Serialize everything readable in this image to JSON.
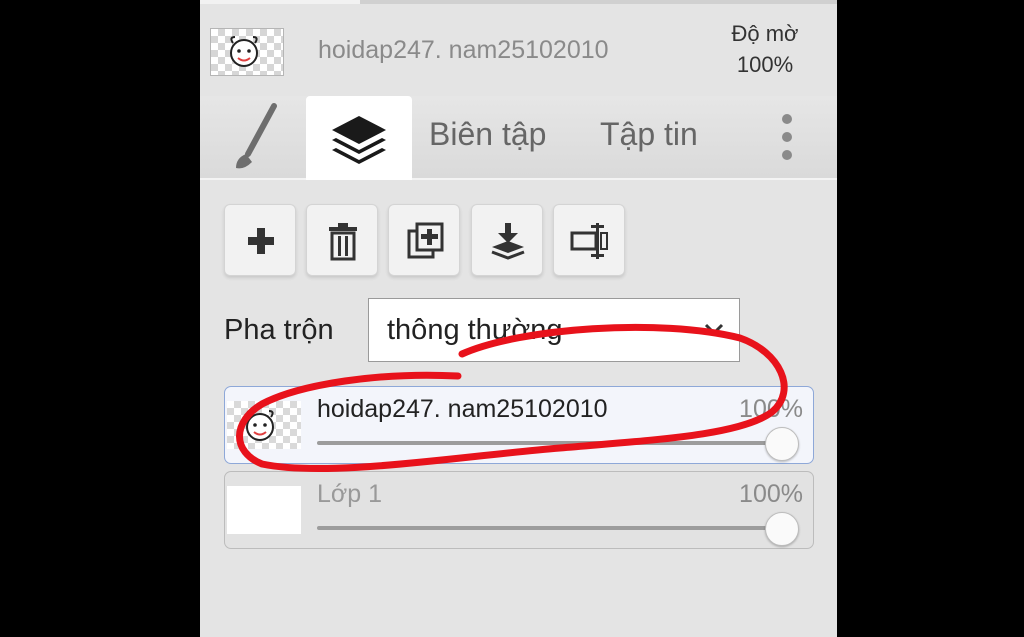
{
  "header": {
    "document_title": "hoidap247. nam25102010",
    "opacity_label": "Độ mờ",
    "opacity_value": "100%",
    "thumbnail_icon": "doodle-face-icon"
  },
  "tabs": {
    "brush_icon": "brush-icon",
    "layers_icon": "layers-icon",
    "edit_label": "Biên tập",
    "file_label": "Tập tin",
    "more_icon": "more-vertical-icon"
  },
  "toolbar": [
    {
      "icon": "plus-icon"
    },
    {
      "icon": "trash-icon"
    },
    {
      "icon": "duplicate-layer-icon"
    },
    {
      "icon": "merge-down-icon"
    },
    {
      "icon": "layer-properties-icon"
    }
  ],
  "blend": {
    "label": "Pha trộn",
    "value": "thông thường"
  },
  "layers": [
    {
      "name": "hoidap247. nam25102010",
      "opacity": "100%",
      "opacity_fraction": 1.0,
      "selected": true
    },
    {
      "name": "Lớp 1",
      "opacity": "100%",
      "opacity_fraction": 1.0,
      "selected": false
    }
  ],
  "colors": {
    "panel_bg": "#e4e4e4",
    "selected_layer_border": "#8ea8d8",
    "annotation_red": "#e8121b"
  }
}
